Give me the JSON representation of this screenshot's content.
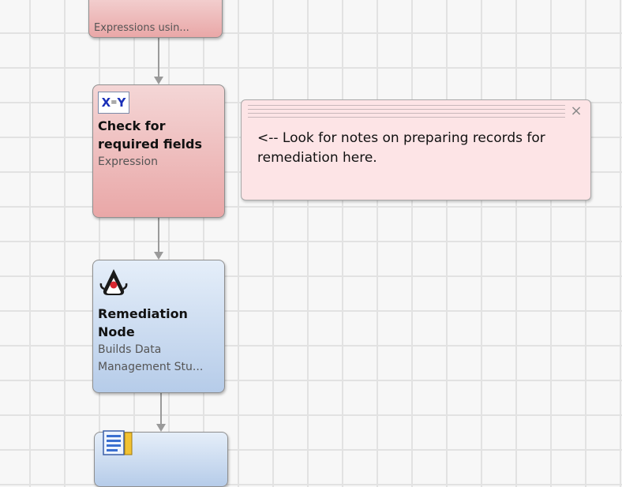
{
  "nodes": {
    "top": {
      "subtitle": "Expressions usin..."
    },
    "check_required": {
      "icon": "x-equals-y-icon",
      "icon_text": {
        "x": "X",
        "eq": "=",
        "y": "Y"
      },
      "title": "Check for required fields",
      "subtitle": "Expression"
    },
    "remediation": {
      "icon": "java-duke-icon",
      "title": "Remediation Node",
      "subtitle_line1": "Builds Data",
      "subtitle_line2": "Management Stu..."
    },
    "bottom": {
      "icon": "document-list-icon"
    }
  },
  "note": {
    "text": "<-- Look for notes on preparing records for remediation here.",
    "close_icon": "close-icon",
    "close_glyph": "×"
  },
  "colors": {
    "node_pink": "#e9a7a7",
    "node_blue": "#b6cce9",
    "note_bg": "#fde4e6",
    "connector": "#9a9a9a"
  }
}
